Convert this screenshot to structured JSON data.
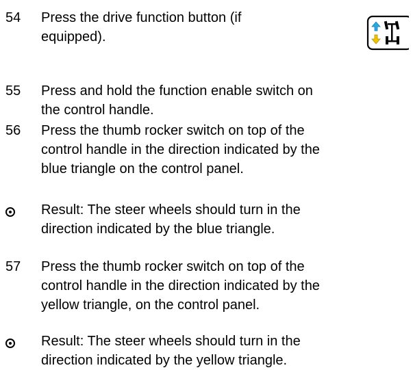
{
  "steps": [
    {
      "number": "54",
      "text": "Press the drive function button (if\nequipped)."
    },
    {
      "number": "55",
      "text": "Press and hold the function enable switch on\nthe control handle."
    },
    {
      "number": "56",
      "text": "Press the thumb rocker switch on top of the\ncontrol handle in the direction indicated by the\nblue triangle on the control panel."
    },
    {
      "number": "57",
      "text": "Press the thumb rocker switch on top of the\ncontrol handle in the direction indicated by the\nyellow triangle, on the control panel."
    }
  ],
  "results": [
    {
      "text": "Result: The steer wheels should turn in the\ndirection indicated by the blue triangle."
    },
    {
      "text": "Result: The steer wheels should turn in the\ndirection indicated by the yellow triangle."
    }
  ],
  "icon": {
    "name": "drive-function-icon",
    "colors": {
      "up_arrow": "#29a9e0",
      "down_arrow": "#f2c500",
      "outline": "#000000"
    }
  }
}
